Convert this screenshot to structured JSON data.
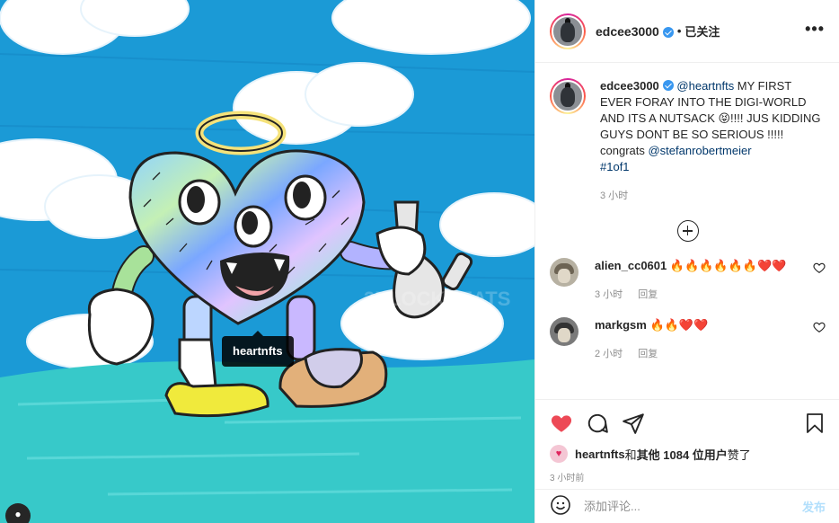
{
  "post": {
    "tag_label": "heartnfts"
  },
  "header": {
    "username": "edcee3000",
    "separator": "•",
    "follow_status": "已关注",
    "more": "•••"
  },
  "caption": {
    "username": "edcee3000",
    "mention": "@heartnfts",
    "text_part1": " MY FIRST EVER FORAY INTO THE DIGI-WORLD AND ITS A NUTSACK ",
    "emoji": "😝",
    "text_part2": "!!!! JUS KIDDING GUYS DONT BE SO SERIOUS !!!!! congrats ",
    "mention2": "@stefanrobertmeier",
    "hashtag": "#1of1",
    "time": "3 小时"
  },
  "comments": [
    {
      "username": "alien_cc0601",
      "text": "🔥🔥🔥🔥🔥🔥❤️❤️",
      "time": "3 小时",
      "reply": "回复"
    },
    {
      "username": "markgsm",
      "text": "🔥🔥❤️❤️",
      "time": "2 小时",
      "reply": "回复"
    }
  ],
  "actions": {
    "likes_user": "heartnfts",
    "likes_and": " 和 ",
    "likes_others": "其他 1084 位用户",
    "likes_suffix": " 赞了",
    "posted_time": "3 小时前"
  },
  "add_comment": {
    "placeholder": "添加评论...",
    "post_label": "发布"
  },
  "colors": {
    "sky": "#1b9ad6",
    "ground": "#37c9c9",
    "like_red": "#ed4956",
    "link_blue": "#00376b",
    "verified_blue": "#3897f0"
  }
}
